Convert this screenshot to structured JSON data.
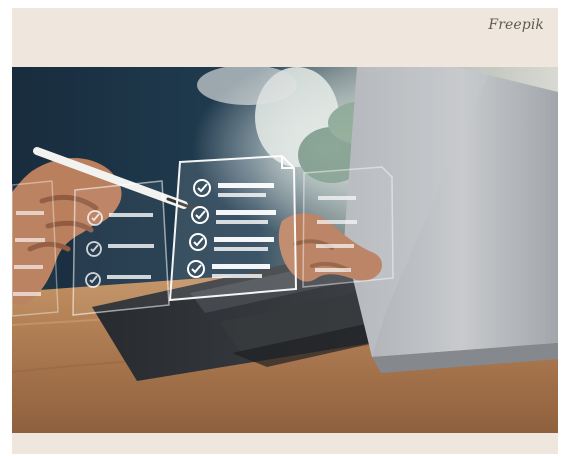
{
  "image": {
    "credit": "Freepik",
    "icons": [
      "checkmark-icon",
      "document-icon"
    ],
    "colors": {
      "background": "#efe7dd",
      "desk": "#b88156",
      "laptop_body": "#b9bcc0",
      "keyboard": "#2a2c30",
      "hologram": "#ffffff",
      "hand": "#b87a57"
    }
  }
}
